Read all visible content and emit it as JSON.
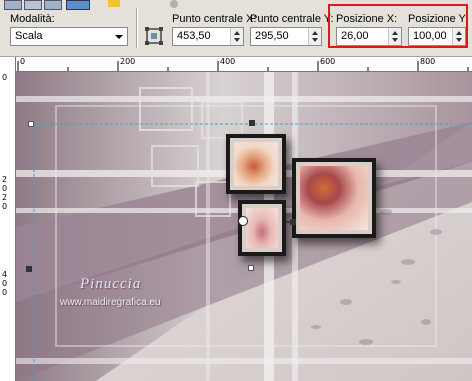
{
  "toolbar": {
    "mode_label": "Modalità:",
    "mode_value": "Scala",
    "center_x_label": "Punto centrale X:",
    "center_x_value": "453,50",
    "center_y_label": "Punto centrale Y:",
    "center_y_value": "295,50",
    "pos_x_label": "Posizione X:",
    "pos_x_value": "26,00",
    "pos_y_label": "Posizione Y:",
    "pos_y_value": "100,00"
  },
  "ruler": {
    "h_labels": [
      "0",
      "200",
      "400",
      "600",
      "800"
    ],
    "v_labels": [
      "0",
      "2",
      "0",
      "2",
      "0",
      "4",
      "0",
      "0"
    ]
  },
  "canvas": {
    "watermark_title": "Pinuccia",
    "watermark_url": "www.maidiregrafica.eu"
  },
  "colors": {
    "highlight": "#e01818",
    "canvas_base": "#a8949e"
  }
}
